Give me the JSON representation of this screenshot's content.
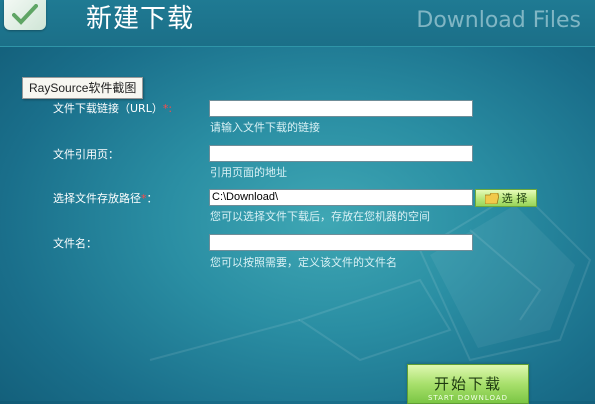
{
  "header": {
    "title": "新建下载",
    "subtitle": "Download Files"
  },
  "tooltip": "RaySource软件截图",
  "form": {
    "url": {
      "label": "文件下载链接（URL）",
      "required": "*:",
      "value": "",
      "hint": "请输入文件下载的链接"
    },
    "referrer": {
      "label": "文件引用页：",
      "value": "",
      "hint": "引用页面的地址"
    },
    "save_path": {
      "label": "选择文件存放路径",
      "required": "*",
      "colon": "：",
      "value": "C:\\Download\\",
      "hint": "您可以选择文件下载后，存放在您机器的空间",
      "browse_label": "选 择"
    },
    "filename": {
      "label": "文件名：",
      "value": "",
      "hint": "您可以按照需要，定义该文件的文件名"
    }
  },
  "start_button": {
    "label": "开始下载",
    "sublabel": "START DOWNLOAD"
  },
  "colors": {
    "background": "#2a8ea3",
    "required": "#ff4a4a",
    "button_green": "#a8e06c"
  }
}
